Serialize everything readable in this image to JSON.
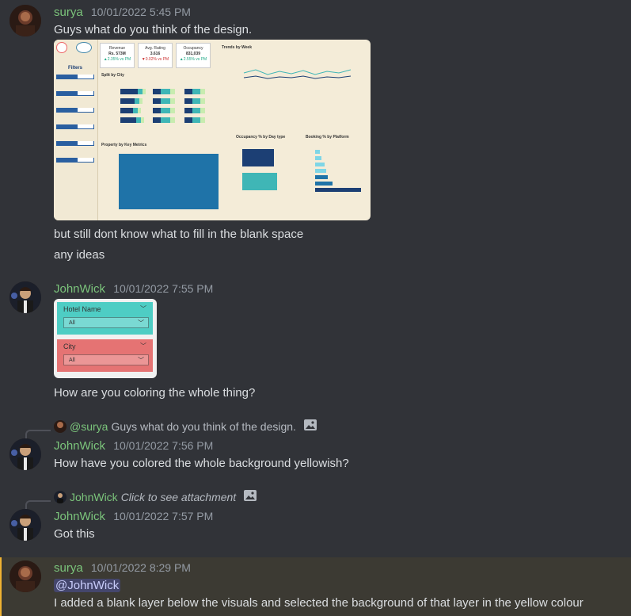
{
  "users": {
    "surya": {
      "name": "surya",
      "color": "#7bc47b"
    },
    "johnwick": {
      "name": "JohnWick",
      "color": "#7bc47b"
    }
  },
  "messages": [
    {
      "author": "surya",
      "timestamp": "10/01/2022 5:45 PM",
      "lines": [
        "Guys what do you think of the design.",
        "but still dont know what to fill in the blank space",
        "any ideas"
      ]
    },
    {
      "author": "JohnWick",
      "timestamp": "10/01/2022 7:55 PM",
      "lines": [
        "How are you coloring the whole thing?"
      ]
    },
    {
      "author": "JohnWick",
      "timestamp": "10/01/2022 7:56 PM",
      "reply_to": {
        "author": "@surya",
        "text": "Guys what do you think of the design."
      },
      "lines": [
        "How have you colored the whole background yellowish?"
      ]
    },
    {
      "author": "JohnWick",
      "timestamp": "10/01/2022 7:57 PM",
      "reply_to": {
        "author": "JohnWick",
        "text": "Click to see attachment"
      },
      "lines": [
        "Got this"
      ]
    },
    {
      "author": "surya",
      "timestamp": "10/01/2022 8:29 PM",
      "mention": "@JohnWick",
      "lines": [
        "I added a blank layer below the visuals and selected the background of that layer in the yellow colour"
      ]
    }
  ],
  "dashboard": {
    "kpis": [
      {
        "label": "Revenue",
        "value": "Rs. 573M",
        "delta": "▲2.35% vs PM"
      },
      {
        "label": "Avg. Rating",
        "value": "3.616",
        "delta": "▼0.02% vs PM"
      },
      {
        "label": "Occupancy",
        "value": "831,039",
        "delta": "▲2.55% vs PM"
      }
    ],
    "filters_title": "Filters",
    "filters": [
      "Property",
      "City",
      "Status",
      "Platform",
      "Month",
      "Week No."
    ],
    "sections": [
      "Split by City",
      "Trends by Week",
      "Property by Key Metrics",
      "Occupancy % by Day type",
      "Booking % by Platform"
    ]
  },
  "filter_snippet": {
    "cards": [
      {
        "title": "Hotel Name",
        "value": "All",
        "color": "#4ecdc4"
      },
      {
        "title": "City",
        "value": "All",
        "color": "#e57373"
      }
    ]
  }
}
